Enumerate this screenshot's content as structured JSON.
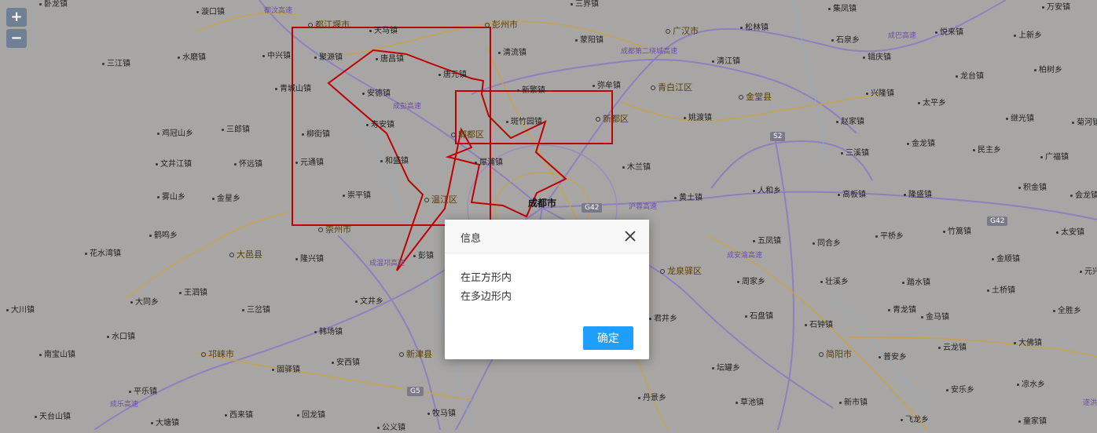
{
  "zoom": {
    "in_label": "+",
    "out_label": "−"
  },
  "map": {
    "places": [
      {
        "name": "卧龙镇",
        "type": "town"
      },
      {
        "name": "漩口镇",
        "type": "town"
      },
      {
        "name": "都江堰市",
        "type": "county"
      },
      {
        "name": "天马镇",
        "type": "town"
      },
      {
        "name": "彭州市",
        "type": "county"
      },
      {
        "name": "三界镇",
        "type": "town"
      },
      {
        "name": "集凤镇",
        "type": "town"
      },
      {
        "name": "万安镇",
        "type": "town"
      },
      {
        "name": "广汉市",
        "type": "county"
      },
      {
        "name": "松林镇",
        "type": "town"
      },
      {
        "name": "蒙阳镇",
        "type": "town"
      },
      {
        "name": "石泉乡",
        "type": "town"
      },
      {
        "name": "悦来镇",
        "type": "town"
      },
      {
        "name": "上新乡",
        "type": "town"
      },
      {
        "name": "三江镇",
        "type": "town"
      },
      {
        "name": "水磨镇",
        "type": "town"
      },
      {
        "name": "中兴镇",
        "type": "town"
      },
      {
        "name": "聚源镇",
        "type": "town"
      },
      {
        "name": "唐昌镇",
        "type": "town"
      },
      {
        "name": "清流镇",
        "type": "town"
      },
      {
        "name": "辑庆镇",
        "type": "town"
      },
      {
        "name": "柏树乡",
        "type": "town"
      },
      {
        "name": "清江镇",
        "type": "town"
      },
      {
        "name": "唐元镇",
        "type": "town"
      },
      {
        "name": "龙台镇",
        "type": "town"
      },
      {
        "name": "弥牟镇",
        "type": "town"
      },
      {
        "name": "青白江区",
        "type": "county"
      },
      {
        "name": "新繁镇",
        "type": "town"
      },
      {
        "name": "青城山镇",
        "type": "town"
      },
      {
        "name": "安德镇",
        "type": "town"
      },
      {
        "name": "金堂县",
        "type": "county"
      },
      {
        "name": "兴隆镇",
        "type": "town"
      },
      {
        "name": "太平乡",
        "type": "town"
      },
      {
        "name": "姚渡镇",
        "type": "town"
      },
      {
        "name": "新都区",
        "type": "county"
      },
      {
        "name": "斑竹园镇",
        "type": "town"
      },
      {
        "name": "赵家镇",
        "type": "town"
      },
      {
        "name": "继光镇",
        "type": "town"
      },
      {
        "name": "菊河镇",
        "type": "town"
      },
      {
        "name": "鸡冠山乡",
        "type": "town"
      },
      {
        "name": "三郎镇",
        "type": "town"
      },
      {
        "name": "寿安镇",
        "type": "town"
      },
      {
        "name": "郫都区",
        "type": "county"
      },
      {
        "name": "柳街镇",
        "type": "town"
      },
      {
        "name": "金龙镇",
        "type": "town"
      },
      {
        "name": "民主乡",
        "type": "town"
      },
      {
        "name": "三溪镇",
        "type": "town"
      },
      {
        "name": "广福镇",
        "type": "town"
      },
      {
        "name": "文井江镇",
        "type": "town"
      },
      {
        "name": "怀远镇",
        "type": "town"
      },
      {
        "name": "元通镇",
        "type": "town"
      },
      {
        "name": "和盛镇",
        "type": "town"
      },
      {
        "name": "犀浦镇",
        "type": "town"
      },
      {
        "name": "木兰镇",
        "type": "town"
      },
      {
        "name": "人和乡",
        "type": "town"
      },
      {
        "name": "积金镇",
        "type": "town"
      },
      {
        "name": "雾山乡",
        "type": "town"
      },
      {
        "name": "金星乡",
        "type": "town"
      },
      {
        "name": "崇平镇",
        "type": "town"
      },
      {
        "name": "温江区",
        "type": "county"
      },
      {
        "name": "成都市",
        "type": "city"
      },
      {
        "name": "黄土镇",
        "type": "town"
      },
      {
        "name": "高板镇",
        "type": "town"
      },
      {
        "name": "隆盛镇",
        "type": "town"
      },
      {
        "name": "会龙镇",
        "type": "town"
      },
      {
        "name": "崇州市",
        "type": "county"
      },
      {
        "name": "鹤鸣乡",
        "type": "town"
      },
      {
        "name": "平桥乡",
        "type": "town"
      },
      {
        "name": "竹篙镇",
        "type": "town"
      },
      {
        "name": "五凤镇",
        "type": "town"
      },
      {
        "name": "同合乡",
        "type": "town"
      },
      {
        "name": "太安镇",
        "type": "town"
      },
      {
        "name": "花水湾镇",
        "type": "town"
      },
      {
        "name": "大邑县",
        "type": "county"
      },
      {
        "name": "隆兴镇",
        "type": "town"
      },
      {
        "name": "彭镇",
        "type": "town"
      },
      {
        "name": "金顺镇",
        "type": "town"
      },
      {
        "name": "元兴",
        "type": "town"
      },
      {
        "name": "龙泉驿区",
        "type": "county"
      },
      {
        "name": "周家乡",
        "type": "town"
      },
      {
        "name": "壮溪乡",
        "type": "town"
      },
      {
        "name": "踏水镇",
        "type": "town"
      },
      {
        "name": "王泗镇",
        "type": "town"
      },
      {
        "name": "土桥镇",
        "type": "town"
      },
      {
        "name": "大川镇",
        "type": "town"
      },
      {
        "name": "大同乡",
        "type": "town"
      },
      {
        "name": "文井乡",
        "type": "town"
      },
      {
        "name": "青龙镇",
        "type": "town"
      },
      {
        "name": "全胜乡",
        "type": "town"
      },
      {
        "name": "三岔镇",
        "type": "town"
      },
      {
        "name": "君井乡",
        "type": "town"
      },
      {
        "name": "石盘镇",
        "type": "town"
      },
      {
        "name": "金马镇",
        "type": "town"
      },
      {
        "name": "水口镇",
        "type": "town"
      },
      {
        "name": "石钟镇",
        "type": "town"
      },
      {
        "name": "韩场镇",
        "type": "town"
      },
      {
        "name": "云龙镇",
        "type": "town"
      },
      {
        "name": "大佛镇",
        "type": "town"
      },
      {
        "name": "南宝山镇",
        "type": "town"
      },
      {
        "name": "邛崃市",
        "type": "county"
      },
      {
        "name": "新津县",
        "type": "county"
      },
      {
        "name": "简阳市",
        "type": "county"
      },
      {
        "name": "普安乡",
        "type": "town"
      },
      {
        "name": "安西镇",
        "type": "town"
      },
      {
        "name": "固驿镇",
        "type": "town"
      },
      {
        "name": "坛罐乡",
        "type": "town"
      },
      {
        "name": "平乐镇",
        "type": "town"
      },
      {
        "name": "安乐乡",
        "type": "town"
      },
      {
        "name": "凉水乡",
        "type": "town"
      },
      {
        "name": "丹景乡",
        "type": "town"
      },
      {
        "name": "草池镇",
        "type": "town"
      },
      {
        "name": "新市镇",
        "type": "town"
      },
      {
        "name": "天台山镇",
        "type": "town"
      },
      {
        "name": "西来镇",
        "type": "town"
      },
      {
        "name": "回龙镇",
        "type": "town"
      },
      {
        "name": "牧马镇",
        "type": "town"
      },
      {
        "name": "飞龙乡",
        "type": "town"
      },
      {
        "name": "童家镇",
        "type": "town"
      },
      {
        "name": "大塘镇",
        "type": "town"
      },
      {
        "name": "公义镇",
        "type": "town"
      }
    ],
    "badges": [
      "S2",
      "G42",
      "G42",
      "G5"
    ],
    "highway_labels": [
      "都汶高速",
      "成都第二绕城高速",
      "成巴高速",
      "成彭高速",
      "沪蓉高速",
      "成安渝高速",
      "成温邛高速",
      "成乐高速",
      "遂洪"
    ],
    "overlay_color": "#c00000"
  },
  "dialog": {
    "title": "信息",
    "lines": [
      "在正方形内",
      "在多边形内"
    ],
    "ok_label": "确定"
  }
}
